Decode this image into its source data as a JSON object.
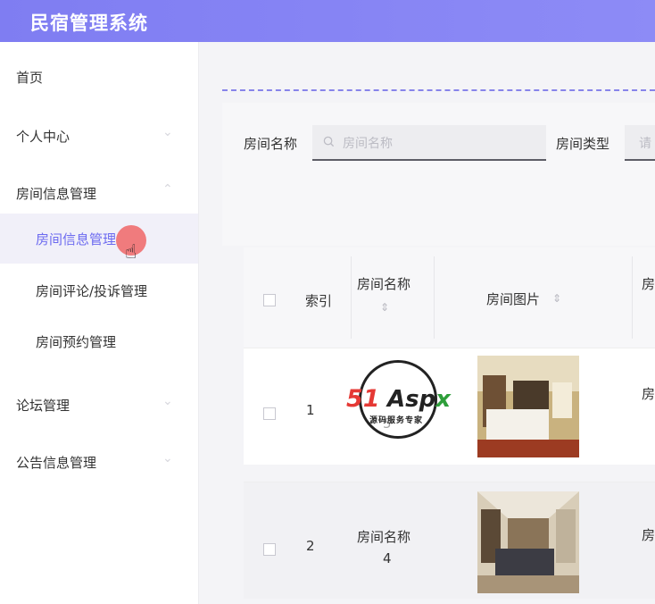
{
  "header": {
    "title": "民宿管理系统"
  },
  "sidebar": {
    "items": [
      {
        "label": "首页"
      },
      {
        "label": "个人中心"
      },
      {
        "label": "房间信息管理"
      },
      {
        "label": "论坛管理"
      },
      {
        "label": "公告信息管理"
      }
    ],
    "subitems": [
      {
        "label": "房间信息管理",
        "active": true
      },
      {
        "label": "房间评论/投诉管理"
      },
      {
        "label": "房间预约管理"
      }
    ]
  },
  "search": {
    "room_name_label": "房间名称",
    "room_name_placeholder": "房间名称",
    "room_type_label": "房间类型",
    "room_type_placeholder": "请"
  },
  "table": {
    "headers": {
      "index": "索引",
      "room_name": "房间名称",
      "room_image": "房间图片",
      "room_type": "房"
    },
    "rows": [
      {
        "index": "1",
        "room_name": "5",
        "type_partial": "房"
      },
      {
        "index": "2",
        "room_name_label": "房间名称",
        "room_name": "4",
        "type_partial": "房"
      }
    ]
  },
  "watermark": {
    "brand_a": "51",
    "brand_b": "Asp",
    "brand_c": "x",
    "tagline": "源码服务专家"
  },
  "colors": {
    "accent": "#7f7df2",
    "active_text": "#6c6af0",
    "cursor": "#ef5a5a"
  }
}
